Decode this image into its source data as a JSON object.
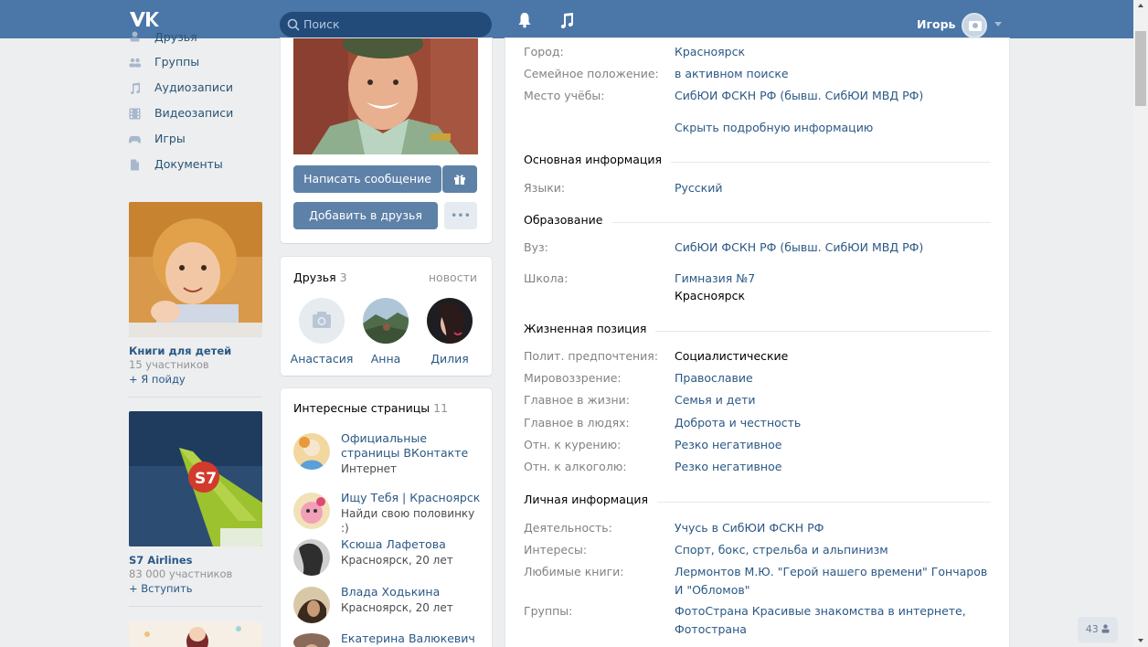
{
  "header": {
    "search_placeholder": "Поиск",
    "user_name": "Игорь"
  },
  "left_menu": {
    "items": [
      {
        "label": "Друзья",
        "icon": "friends-icon"
      },
      {
        "label": "Группы",
        "icon": "groups-icon"
      },
      {
        "label": "Аудиозаписи",
        "icon": "audio-icon"
      },
      {
        "label": "Видеозаписи",
        "icon": "video-icon"
      },
      {
        "label": "Игры",
        "icon": "games-icon"
      },
      {
        "label": "Документы",
        "icon": "documents-icon"
      }
    ]
  },
  "ads": [
    {
      "title": "Книги для детей",
      "subtitle": "15 участников",
      "action": "+ Я пойду"
    },
    {
      "title": "S7 Airlines",
      "subtitle": "83 000 участников",
      "action": "+ Вступить"
    }
  ],
  "profile": {
    "write_message": "Написать сообщение",
    "add_friend": "Добавить в друзья",
    "more": "•••"
  },
  "friends": {
    "title": "Друзья",
    "count": "3",
    "news_link": "новости",
    "list": [
      {
        "name": "Анастасия"
      },
      {
        "name": "Анна"
      },
      {
        "name": "Дилия"
      }
    ]
  },
  "pages": {
    "title": "Интересные страницы",
    "count": "11",
    "items": [
      {
        "name": "Официальные страницы ВКонтакте",
        "sub": "Интернет"
      },
      {
        "name": "Ищу Тебя | Красноярск",
        "sub": "Найди свою половинку :)"
      },
      {
        "name": "Ксюша Лафетова",
        "sub": "Красноярск, 20 лет"
      },
      {
        "name": "Влада Ходькина",
        "sub": "Красноярск, 20 лет"
      },
      {
        "name": "Екатерина Валюкевич",
        "sub": ""
      }
    ]
  },
  "info": {
    "top_rows": [
      {
        "k": "Город:",
        "v": "Красноярск"
      },
      {
        "k": "Семейное положение:",
        "v": "в активном поиске"
      },
      {
        "k": "Место учёбы:",
        "v": "СибЮИ ФСКН РФ (бывш. СибЮИ МВД РФ)"
      }
    ],
    "hide_link": "Скрыть подробную информацию",
    "basic": {
      "title": "Основная информация",
      "rows": [
        {
          "k": "Языки:",
          "v": "Русский"
        }
      ]
    },
    "education": {
      "title": "Образование",
      "uni": {
        "k": "Вуз:",
        "v": "СибЮИ ФСКН РФ (бывш. СибЮИ МВД РФ)"
      },
      "school": {
        "k": "Школа:",
        "v": "Гимназия №7",
        "city": "Красноярск"
      }
    },
    "life": {
      "title": "Жизненная позиция",
      "rows": [
        {
          "k": "Полит. предпочтения:",
          "v": "Социалистические"
        },
        {
          "k": "Мировоззрение:",
          "v": "Православие"
        },
        {
          "k": "Главное в жизни:",
          "v": "Семья и дети"
        },
        {
          "k": "Главное в людях:",
          "v": "Доброта и честность"
        },
        {
          "k": "Отн. к курению:",
          "v": "Резко негативное"
        },
        {
          "k": "Отн. к алкоголю:",
          "v": "Резко негативное"
        }
      ]
    },
    "personal": {
      "title": "Личная информация",
      "rows": [
        {
          "k": "Деятельность:",
          "v": "Учусь в СибЮИ ФСКН РФ"
        },
        {
          "k": "Интересы:",
          "v": "Спорт, бокс, стрельба и альпинизм"
        },
        {
          "k": "Любимые книги:",
          "v": "Лермонтов М.Ю. \"Герой нашего времени\" Гончаров И \"Обломов\""
        },
        {
          "k": "Группы:",
          "v": "ФотоСтрана Красивые знакомства в интернете, Фотострана"
        }
      ]
    }
  },
  "online_badge": "43"
}
